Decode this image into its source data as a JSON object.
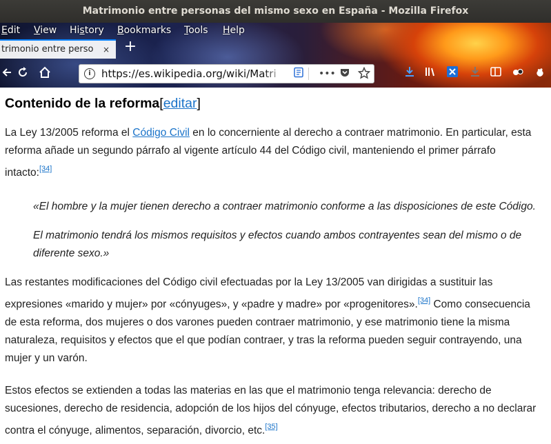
{
  "window": {
    "title": "Matrimonio entre personas del mismo sexo en España - Mozilla Firefox"
  },
  "menu": {
    "items": [
      {
        "pre": "",
        "ul": "E",
        "post": "dit"
      },
      {
        "pre": "",
        "ul": "V",
        "post": "iew"
      },
      {
        "pre": "Hi",
        "ul": "s",
        "post": "tory"
      },
      {
        "pre": "",
        "ul": "B",
        "post": "ookmarks"
      },
      {
        "pre": "",
        "ul": "T",
        "post": "ools"
      },
      {
        "pre": "",
        "ul": "H",
        "post": "elp"
      }
    ]
  },
  "tab": {
    "title": "trimonio entre perso",
    "close": "×",
    "new_tab": "+"
  },
  "nav": {
    "url": "https://es.wikipedia.org/wiki/Matri",
    "info": "i",
    "more": "•••"
  },
  "icons": {
    "back": "back-arrow-icon",
    "reload": "reload-icon",
    "home": "home-icon",
    "reader": "reader-view-icon",
    "pocket": "pocket-icon",
    "bookmark": "bookmark-star-icon",
    "downloads": "download-icon",
    "library": "library-icon",
    "extension": "extension-icon",
    "sync": "sync-icon",
    "sidebar": "sidebar-icon",
    "addon": "addon-icon",
    "gnome": "gnome-icon"
  },
  "article": {
    "heading": "Contenido de la reforma",
    "edit_open": "[",
    "edit_link": "editar",
    "edit_close": "]",
    "p1": {
      "l1a": "La Ley 13/2005 reforma el ",
      "l1link": "Código Civil",
      "l1b": " en lo concerniente al derecho a contraer matrimonio. En particular, esta",
      "l2": "reforma añade un segundo párrafo al vigente artículo 44 del Código civil, manteniendo el primer párrafo",
      "l3": "intacto:",
      "ref": "[34]"
    },
    "quote": {
      "q1": "«El hombre y la mujer tienen derecho a contraer matrimonio conforme a las disposiciones de este Código.",
      "q2a": "El matrimonio tendrá los mismos requisitos y efectos cuando ambos contrayentes sean del mismo o de",
      "q2b": "diferente sexo.»"
    },
    "p2": {
      "l1": "Las restantes modificaciones del Código civil efectuadas por la Ley 13/2005 van dirigidas a sustituir las",
      "l2a": "expresiones «marido y mujer» por «cónyuges», y «padre y madre» por «progenitores».",
      "ref": "[34]",
      "l2b": " Como consecuencia",
      "l3": "de esta reforma, dos mujeres o dos varones pueden contraer matrimonio, y ese matrimonio tiene la misma",
      "l4": "naturaleza, requisitos y efectos que el que podían contraer, y tras la reforma pueden seguir contrayendo, una",
      "l5": "mujer y un varón."
    },
    "p3": {
      "l1": "Estos efectos se extienden a todas las materias en las que el matrimonio tenga relevancia: derecho de",
      "l2": "sucesiones, derecho de residencia, adopción de los hijos del cónyuge, efectos tributarios, derecho a no declarar",
      "l3": "contra el cónyuge, alimentos, separación, divorcio, etc.",
      "ref": "[35]"
    }
  }
}
